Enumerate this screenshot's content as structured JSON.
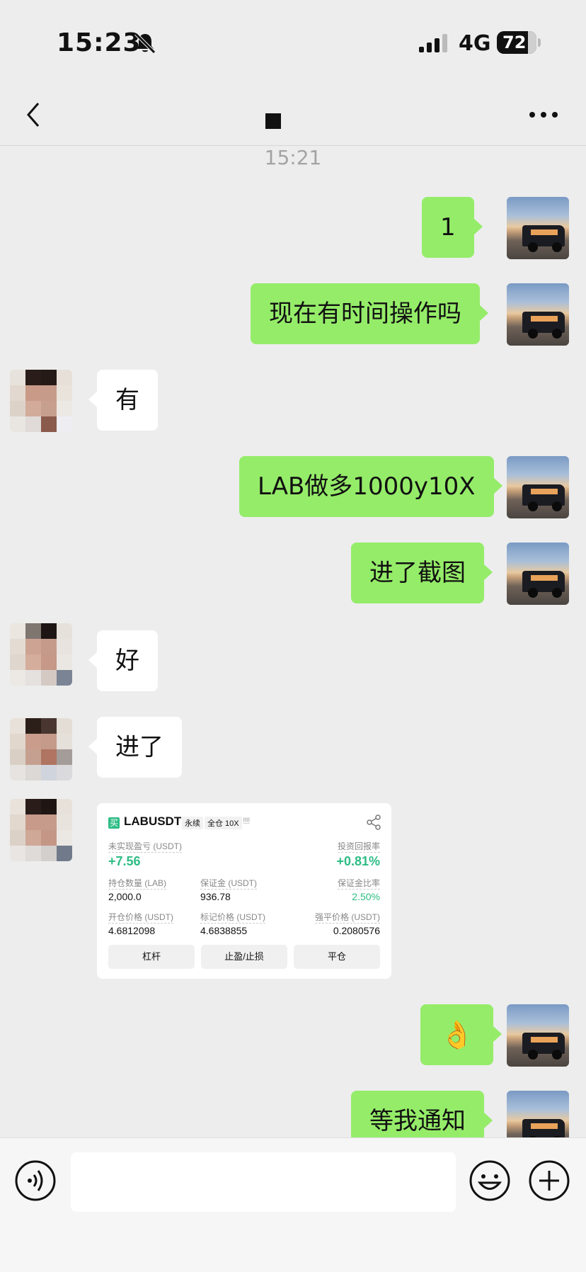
{
  "status_bar": {
    "time": "15:23",
    "network": "4G",
    "battery": "72"
  },
  "nav": {
    "title": "■"
  },
  "timestamp": "15:21",
  "messages": [
    {
      "from": "me",
      "text": "1"
    },
    {
      "from": "me",
      "text": "现在有时间操作吗"
    },
    {
      "from": "other",
      "text": "有"
    },
    {
      "from": "me",
      "text": "LAB做多1000y10X"
    },
    {
      "from": "me",
      "text": "进了截图"
    },
    {
      "from": "other",
      "text": "好"
    },
    {
      "from": "other",
      "text": "进了"
    },
    {
      "from": "me",
      "text": "👌"
    },
    {
      "from": "me",
      "text": "等我通知"
    }
  ],
  "trade_card": {
    "buy_tag": "买",
    "symbol": "LABUSDT",
    "tag_perpetual": "永续",
    "tag_margin": "全仓 10X",
    "bars": "!!!!",
    "unrealized_label": "未实现盈亏 (USDT)",
    "unrealized_value": "+7.56",
    "roi_label": "投资回报率",
    "roi_value": "+0.81%",
    "position_label": "持仓数量 (LAB)",
    "position_value": "2,000.0",
    "margin_label": "保证金 (USDT)",
    "margin_value": "936.78",
    "margin_ratio_label": "保证金比率",
    "margin_ratio_value": "2.50%",
    "entry_label": "开仓价格 (USDT)",
    "entry_value": "4.6812098",
    "mark_label": "标记价格 (USDT)",
    "mark_value": "4.6838855",
    "liq_label": "强平价格 (USDT)",
    "liq_value": "0.2080576",
    "btn_leverage": "杠杆",
    "btn_tpsl": "止盈/止损",
    "btn_close": "平仓"
  },
  "colors": {
    "me_bubble": "#95ec69",
    "other_bubble": "#ffffff",
    "background": "#ededed",
    "profit_green": "#2ebd85"
  },
  "icons": [
    "bell-slash-icon",
    "signal-icon",
    "back-chevron-icon",
    "more-dots-icon",
    "share-icon",
    "voice-icon",
    "emoji-icon",
    "plus-icon"
  ]
}
